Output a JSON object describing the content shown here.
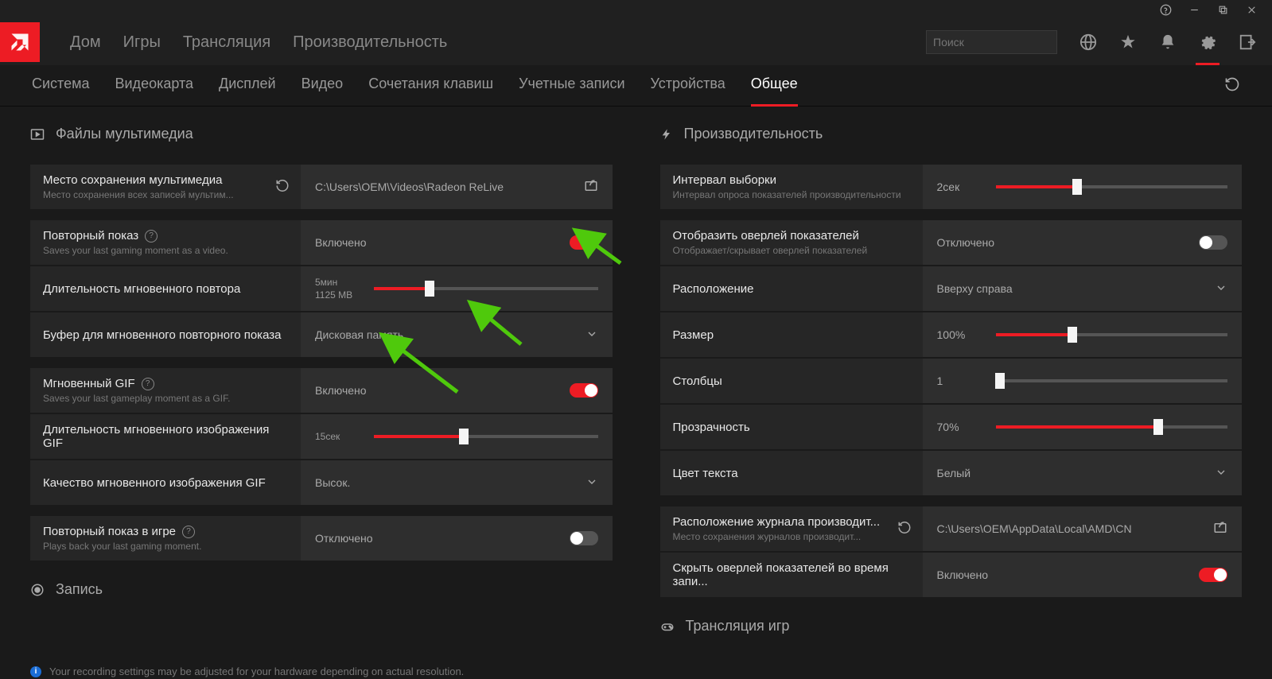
{
  "titlebar": {
    "help": "?",
    "minimize": "—",
    "maximize": "▢",
    "close": "✕"
  },
  "nav": {
    "items": [
      "Дом",
      "Игры",
      "Трансляция",
      "Производительность"
    ],
    "search_placeholder": "Поиск"
  },
  "subnav": {
    "items": [
      "Система",
      "Видеокарта",
      "Дисплей",
      "Видео",
      "Сочетания клавиш",
      "Учетные записи",
      "Устройства",
      "Общее"
    ],
    "active": 7
  },
  "sections": {
    "media": {
      "title": "Файлы мультимедиа"
    },
    "perf": {
      "title": "Производительность"
    },
    "record": {
      "title": "Запись"
    },
    "gstream": {
      "title": "Трансляция игр"
    }
  },
  "left": {
    "save_loc": {
      "title": "Место сохранения мультимедиа",
      "sub": "Место сохранения всех записей мультим...",
      "value": "C:\\Users\\OEM\\Videos\\Radeon ReLive"
    },
    "replay": {
      "title": "Повторный показ",
      "sub": "Saves your last gaming moment as a video.",
      "value": "Включено",
      "on": true
    },
    "replay_dur": {
      "title": "Длительность мгновенного повтора",
      "v1": "5мин",
      "v2": "1125 MB",
      "pct": 25
    },
    "buffer": {
      "title": "Буфер для мгновенного повторного показа",
      "value": "Дисковая память"
    },
    "gif": {
      "title": "Мгновенный GIF",
      "sub": "Saves your last gameplay moment as a GIF.",
      "value": "Включено",
      "on": true
    },
    "gif_dur": {
      "title": "Длительность мгновенного изображения GIF",
      "v1": "15сек",
      "pct": 40
    },
    "gif_q": {
      "title": "Качество мгновенного изображения GIF",
      "value": "Высок."
    },
    "ingame": {
      "title": "Повторный показ в игре",
      "sub": "Plays back your last gaming moment.",
      "value": "Отключено",
      "on": false
    }
  },
  "right": {
    "interval": {
      "title": "Интервал выборки",
      "sub": "Интервал опроса показателей производительности",
      "value": "2сек",
      "pct": 35
    },
    "overlay": {
      "title": "Отобразить оверлей показателей",
      "sub": "Отображает/скрывает оверлей показателей",
      "value": "Отключено",
      "on": false
    },
    "position": {
      "title": "Расположение",
      "value": "Вверху справа"
    },
    "size": {
      "title": "Размер",
      "value": "100%",
      "pct": 33
    },
    "cols": {
      "title": "Столбцы",
      "value": "1",
      "pct": 2
    },
    "opacity": {
      "title": "Прозрачность",
      "value": "70%",
      "pct": 70
    },
    "textcol": {
      "title": "Цвет текста",
      "value": "Белый"
    },
    "loglog": {
      "title": "Расположение журнала производит...",
      "sub": "Место сохранения журналов производит...",
      "value": "C:\\Users\\OEM\\AppData\\Local\\AMD\\CN"
    },
    "hideov": {
      "title": "Скрыть оверлей показателей во время запи...",
      "value": "Включено",
      "on": true
    }
  },
  "footer": {
    "msg": "Your recording settings may be adjusted for your hardware depending on actual resolution."
  }
}
